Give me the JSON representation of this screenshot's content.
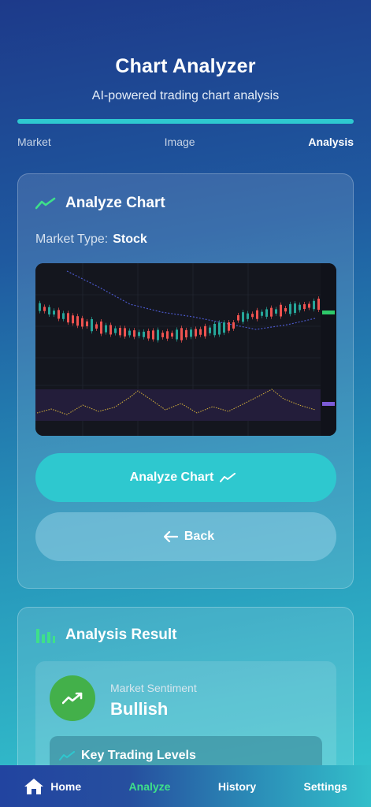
{
  "header": {
    "title": "Chart Analyzer",
    "subtitle": "AI-powered trading chart analysis"
  },
  "steps": [
    {
      "label": "Market",
      "active": false
    },
    {
      "label": "Image",
      "active": false
    },
    {
      "label": "Analysis",
      "active": true
    }
  ],
  "analyze_card": {
    "title": "Analyze Chart",
    "title_icon": "trending-up-icon",
    "market_type_label": "Market Type:",
    "market_type_value": "Stock",
    "analyze_button": "Analyze Chart",
    "back_button": "Back"
  },
  "result_card": {
    "title": "Analysis Result",
    "title_icon": "bar-chart-icon",
    "sentiment_label": "Market Sentiment",
    "sentiment_value": "Bullish",
    "levels_title": "Key Trading Levels"
  },
  "nav": {
    "home": "Home",
    "analyze": "Analyze",
    "history": "History",
    "settings": "Settings"
  },
  "colors": {
    "accent": "#2ec8cf",
    "green": "#43b04a",
    "active_nav": "#3ee08a"
  }
}
